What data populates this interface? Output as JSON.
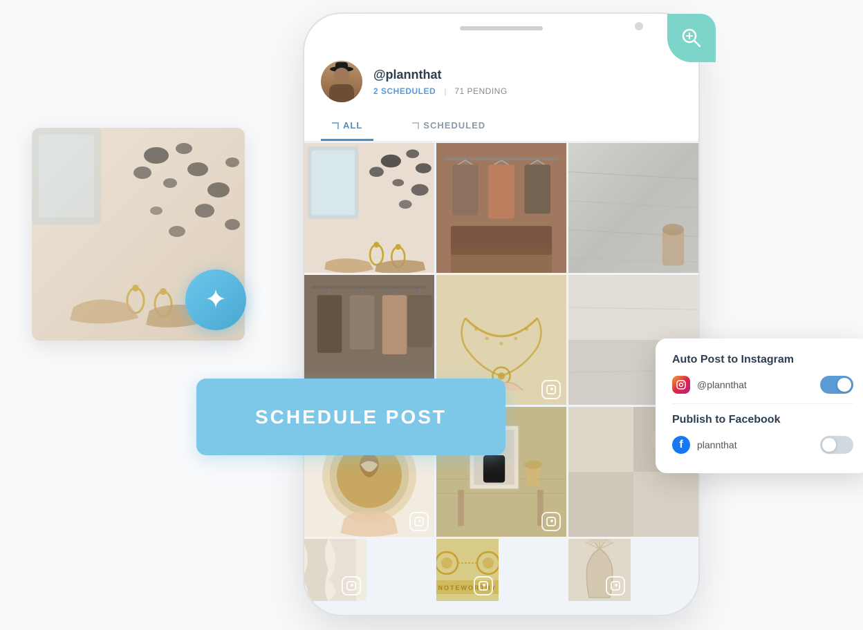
{
  "page": {
    "background": "#ffffff"
  },
  "profile": {
    "username": "@plannthat",
    "scheduled_count": "2 SCHEDULED",
    "pending_count": "71 PENDING",
    "divider": "|"
  },
  "tabs": [
    {
      "label": "ALL",
      "active": true
    },
    {
      "label": "SCHEDULED",
      "active": false
    }
  ],
  "schedule_button": {
    "label": "SCHEDULE POST"
  },
  "popup": {
    "instagram_title": "Auto Post to Instagram",
    "instagram_account": "@plannthat",
    "instagram_toggle": "on",
    "facebook_title": "Publish to Facebook",
    "facebook_account": "plannthat",
    "facebook_toggle": "off"
  },
  "zoom_badge": {
    "icon": "🔍"
  },
  "sparkle_btn": {
    "icon": "✦"
  }
}
